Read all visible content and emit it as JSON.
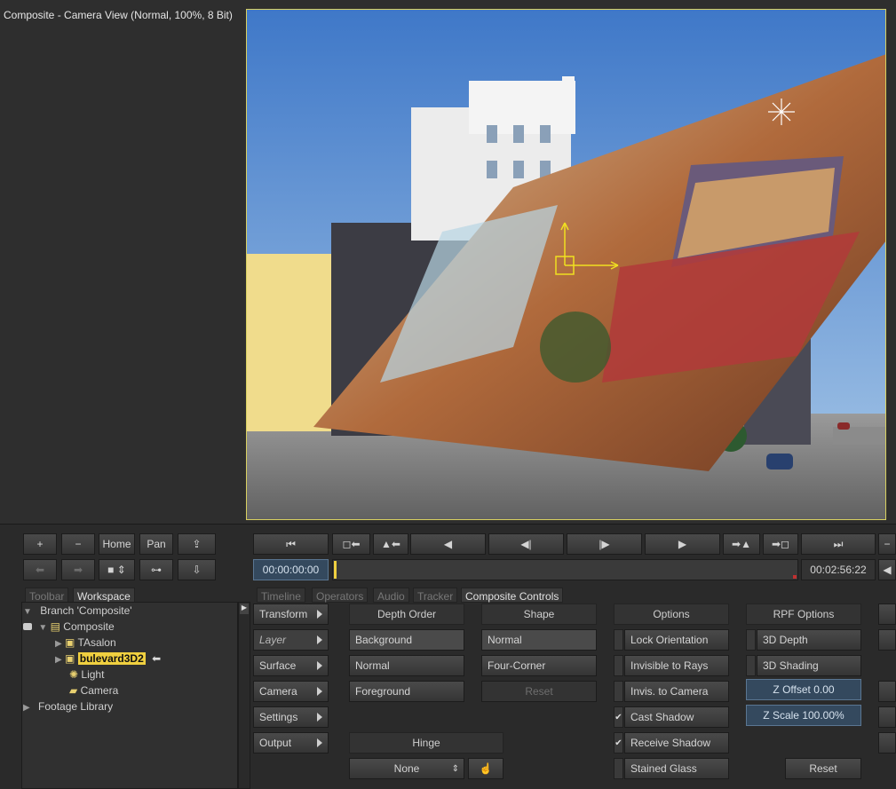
{
  "window": {
    "title": "Composite - Camera View (Normal, 100%, 8 Bit)"
  },
  "nav_buttons": {
    "home": "Home",
    "pan": "Pan"
  },
  "transport": {
    "current_time": "00:00:00:00",
    "end_time": "00:02:56:22"
  },
  "left_tabs": [
    "Toolbar",
    "Workspace"
  ],
  "right_tabs": [
    "Timeline",
    "Operators",
    "Audio",
    "Tracker",
    "Composite Controls"
  ],
  "tree": {
    "branch": "Branch 'Composite'",
    "composite": "Composite",
    "items": [
      "TAsalon",
      "bulevard3D2",
      "Light",
      "Camera"
    ],
    "footage": "Footage Library"
  },
  "categories": [
    "Transform",
    "Layer",
    "Surface",
    "Camera",
    "Settings",
    "Output"
  ],
  "depth_order": {
    "header": "Depth Order",
    "options": [
      "Background",
      "Normal",
      "Foreground"
    ]
  },
  "shape": {
    "header": "Shape",
    "options": [
      "Normal",
      "Four-Corner"
    ],
    "reset": "Reset"
  },
  "options": {
    "header": "Options",
    "items": [
      {
        "label": "Lock Orientation",
        "checked": false
      },
      {
        "label": "Invisible to Rays",
        "checked": false
      },
      {
        "label": "Invis. to Camera",
        "checked": false
      },
      {
        "label": "Cast Shadow",
        "checked": true
      },
      {
        "label": "Receive Shadow",
        "checked": true
      },
      {
        "label": "Stained Glass",
        "checked": false
      }
    ]
  },
  "rpf": {
    "header": "RPF Options",
    "depth": "3D Depth",
    "shading": "3D Shading",
    "z_offset": "Z Offset 0.00",
    "z_scale": "Z Scale 100.00%",
    "reset": "Reset"
  },
  "hinge": {
    "header": "Hinge",
    "value": "None"
  },
  "colors": {
    "accent_yellow": "#f0d040",
    "selection_blue": "#34495e"
  }
}
